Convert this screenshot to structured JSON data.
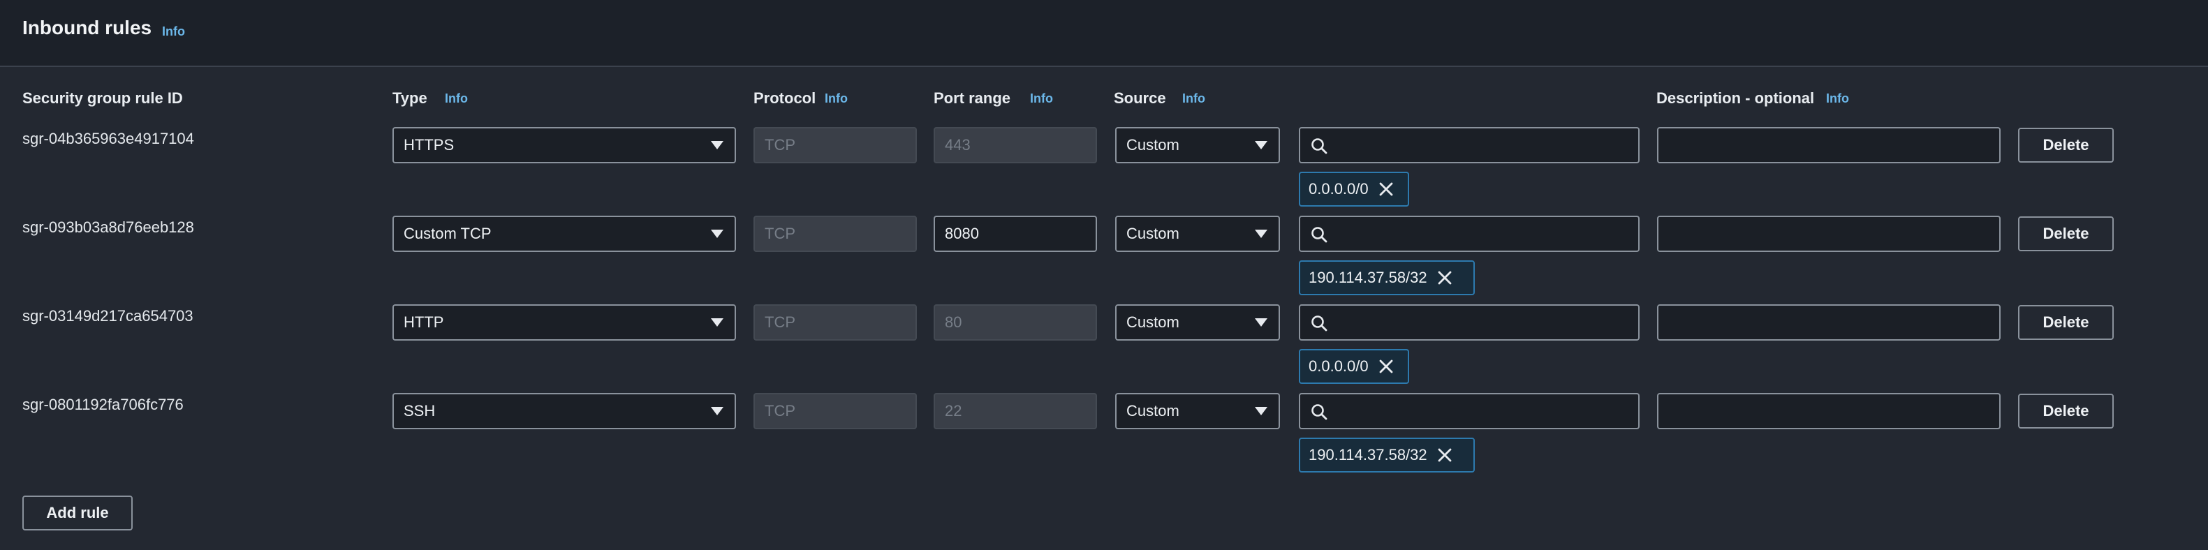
{
  "section": {
    "title": "Inbound rules",
    "info": "Info"
  },
  "columns": {
    "rule_id": "Security group rule ID",
    "type": "Type",
    "protocol": "Protocol",
    "port_range": "Port range",
    "source": "Source",
    "description": "Description - optional",
    "info": "Info"
  },
  "rules": [
    {
      "id": "sgr-04b365963e4917104",
      "type": "HTTPS",
      "protocol": "TCP",
      "port": "443",
      "port_editable": false,
      "source_type": "Custom",
      "source_search": "",
      "cidr": "0.0.0.0/0",
      "description": "",
      "delete": "Delete"
    },
    {
      "id": "sgr-093b03a8d76eeb128",
      "type": "Custom TCP",
      "protocol": "TCP",
      "port": "8080",
      "port_editable": true,
      "source_type": "Custom",
      "source_search": "",
      "cidr": "190.114.37.58/32",
      "description": "",
      "delete": "Delete"
    },
    {
      "id": "sgr-03149d217ca654703",
      "type": "HTTP",
      "protocol": "TCP",
      "port": "80",
      "port_editable": false,
      "source_type": "Custom",
      "source_search": "",
      "cidr": "0.0.0.0/0",
      "description": "",
      "delete": "Delete"
    },
    {
      "id": "sgr-0801192fa706fc776",
      "type": "SSH",
      "protocol": "TCP",
      "port": "22",
      "port_editable": false,
      "source_type": "Custom",
      "source_search": "",
      "cidr": "190.114.37.58/32",
      "description": "",
      "delete": "Delete"
    }
  ],
  "add_rule": "Add rule",
  "colors": {
    "background": "#232831",
    "header": "#1c2129",
    "info_link": "#6cb8ea",
    "token_border": "#2d7aae",
    "token_bg": "#182c3b"
  }
}
